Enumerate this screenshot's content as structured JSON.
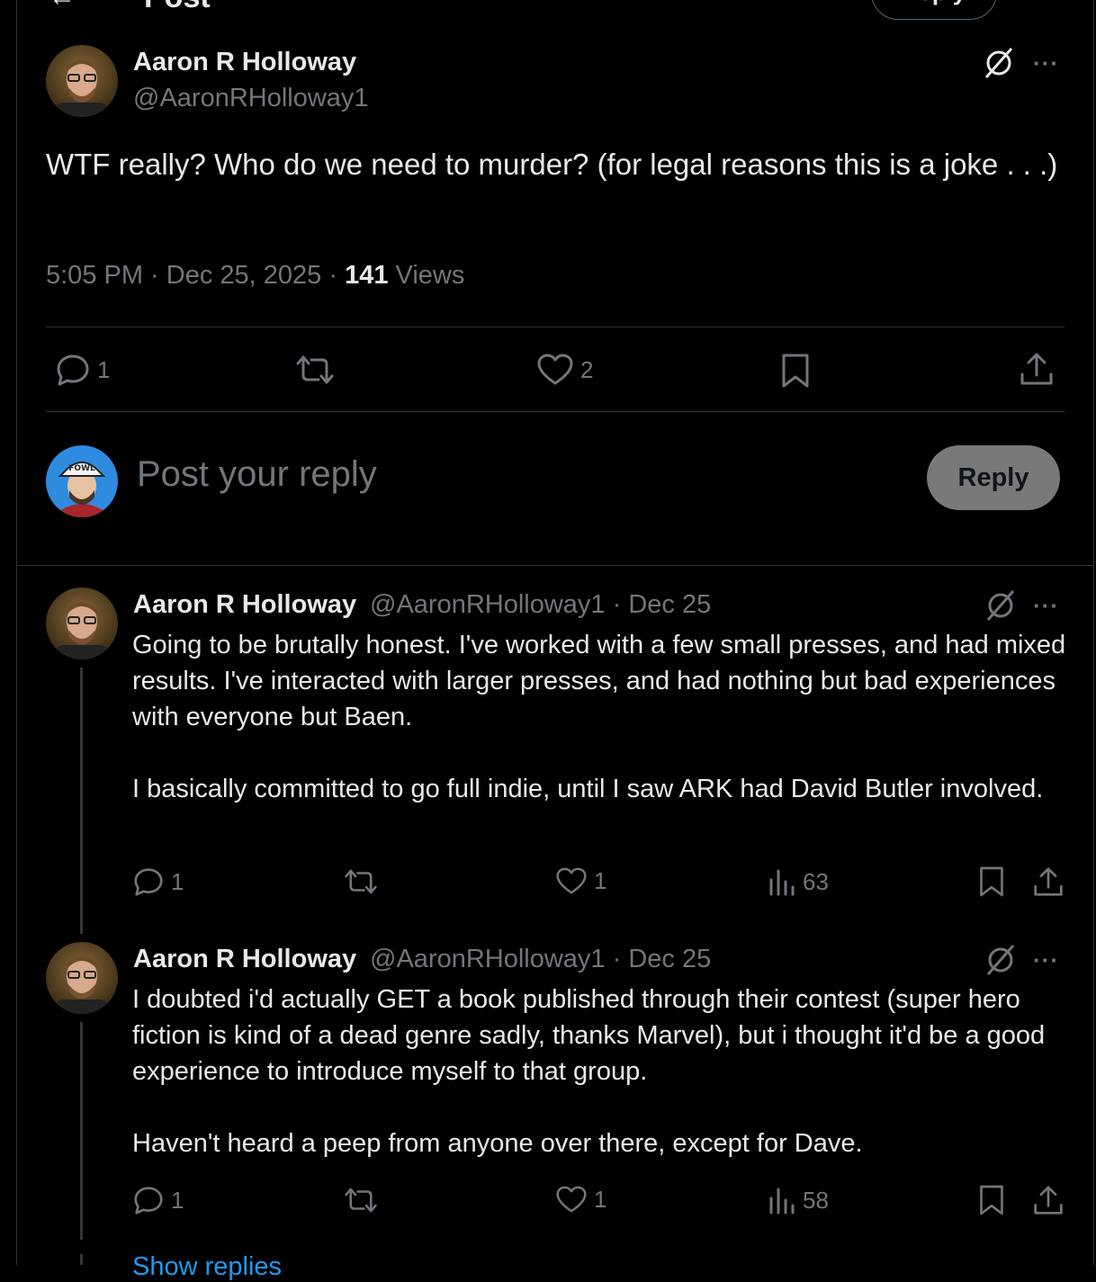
{
  "header": {
    "title": "Post",
    "reply_button": "Reply"
  },
  "main_post": {
    "author_name": "Aaron R Holloway",
    "author_handle": "@AaronRHolloway1",
    "text": "WTF really? Who do we need to murder? (for legal reasons this is a joke . . .)",
    "time": "5:05 PM · Dec 25, 2025 · ",
    "views_count": "141",
    "views_label": " Views",
    "replies": "1",
    "likes": "2",
    "more_label": "···"
  },
  "composer": {
    "placeholder": "Post your reply",
    "button": "Reply"
  },
  "replies": [
    {
      "author_name": "Aaron R Holloway",
      "author_handle": "@AaronRHolloway1 · Dec 25",
      "para1": "Going to be brutally honest. I've worked with a few small presses, and had mixed results. I've interacted with larger presses, and had nothing but bad experiences with everyone but Baen.",
      "para2": "I basically committed to go full indie, until I saw ARK had David Butler involved.",
      "replies": "1",
      "likes": "1",
      "views": "63"
    },
    {
      "author_name": "Aaron R Holloway",
      "author_handle": "@AaronRHolloway1 · Dec 25",
      "para1": "I doubted i'd actually GET a book published through their contest (super hero fiction is kind of a dead genre sadly, thanks Marvel), but i thought it'd be a good experience to introduce myself to that group.",
      "para2": "Haven't heard a peep from anyone over there, except for Dave.",
      "replies": "1",
      "likes": "1",
      "views": "58"
    }
  ],
  "show_more": "Show replies",
  "colors": {
    "background": "#000000",
    "text": "#e7e9ea",
    "muted": "#71767b",
    "border": "#2f3336",
    "link": "#1d9bf0"
  },
  "icons": [
    "back-arrow-icon",
    "reader-icon",
    "grok-icon",
    "more-icon",
    "reply-icon",
    "repost-icon",
    "like-icon",
    "bookmark-icon",
    "share-icon",
    "views-icon"
  ]
}
